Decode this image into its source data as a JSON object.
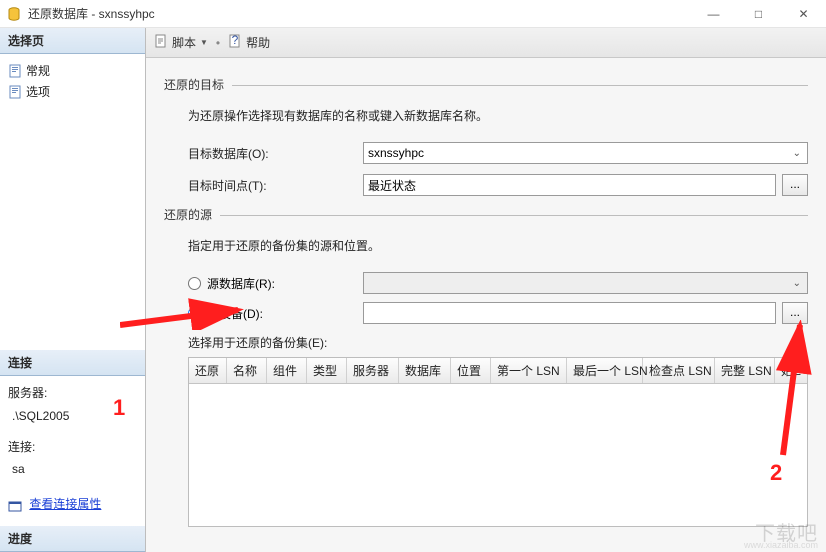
{
  "window": {
    "title": "还原数据库 - sxnssyhpc",
    "controls": {
      "min": "—",
      "max": "□",
      "close": "✕"
    }
  },
  "left": {
    "select_page_header": "选择页",
    "tree": {
      "general": "常规",
      "options": "选项"
    },
    "connection_header": "连接",
    "server_label": "服务器:",
    "server_value": ".\\SQL2005",
    "conn_label": "连接:",
    "conn_value": "sa",
    "view_props": "查看连接属性",
    "progress_header": "进度"
  },
  "toolbar": {
    "script": "脚本",
    "help": "帮助"
  },
  "target": {
    "group": "还原的目标",
    "hint": "为还原操作选择现有数据库的名称或键入新数据库名称。",
    "db_label": "目标数据库(O):",
    "db_value": "sxnssyhpc",
    "time_label": "目标时间点(T):",
    "time_value": "最近状态"
  },
  "source": {
    "group": "还原的源",
    "hint": "指定用于还原的备份集的源和位置。",
    "radio_db": "源数据库(R):",
    "radio_device": "源设备(D):",
    "device_value": "",
    "sets_label": "选择用于还原的备份集(E):"
  },
  "table": {
    "cols": [
      "还原",
      "名称",
      "组件",
      "类型",
      "服务器",
      "数据库",
      "位置",
      "第一个 LSN",
      "最后一个 LSN",
      "检查点 LSN",
      "完整 LSN",
      "始E"
    ]
  },
  "annotations": {
    "one": "1",
    "two": "2"
  },
  "watermark": {
    "logo": "下载吧",
    "url": "www.xiazaiba.com"
  }
}
